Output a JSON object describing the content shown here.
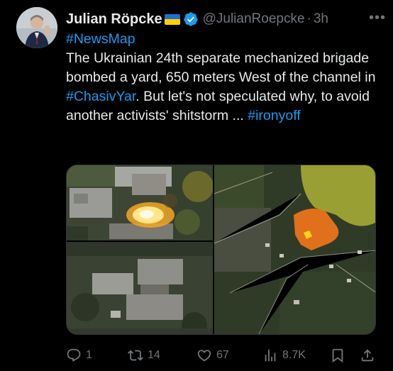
{
  "author": {
    "display_name": "Julian Röpcke",
    "handle": "@JulianRoepcke",
    "time": "3h"
  },
  "post": {
    "line1_hashtag": "#NewsMap",
    "text_a": "The Ukrainian 24th separate mechanized brigade bombed a yard, 650 meters West of the channel in ",
    "hashtag_a": "#ChasivYar",
    "text_b": ". But let's not speculated why, to avoid another activists' shitstorm ... ",
    "hashtag_b": "#ironyoff"
  },
  "metrics": {
    "replies": "1",
    "reposts": "14",
    "likes": "67",
    "views": "8.7K"
  },
  "icons": {
    "reply": "reply-icon",
    "repost": "repost-icon",
    "like": "heart-icon",
    "views": "views-icon",
    "bookmark": "bookmark-icon",
    "share": "share-icon",
    "verified": "verified-badge-icon",
    "more": "more-icon"
  },
  "colors": {
    "accent": "#1d9bf0",
    "muted": "#71767b",
    "flag_blue": "#1f6fd6",
    "flag_yellow": "#ffd400"
  }
}
